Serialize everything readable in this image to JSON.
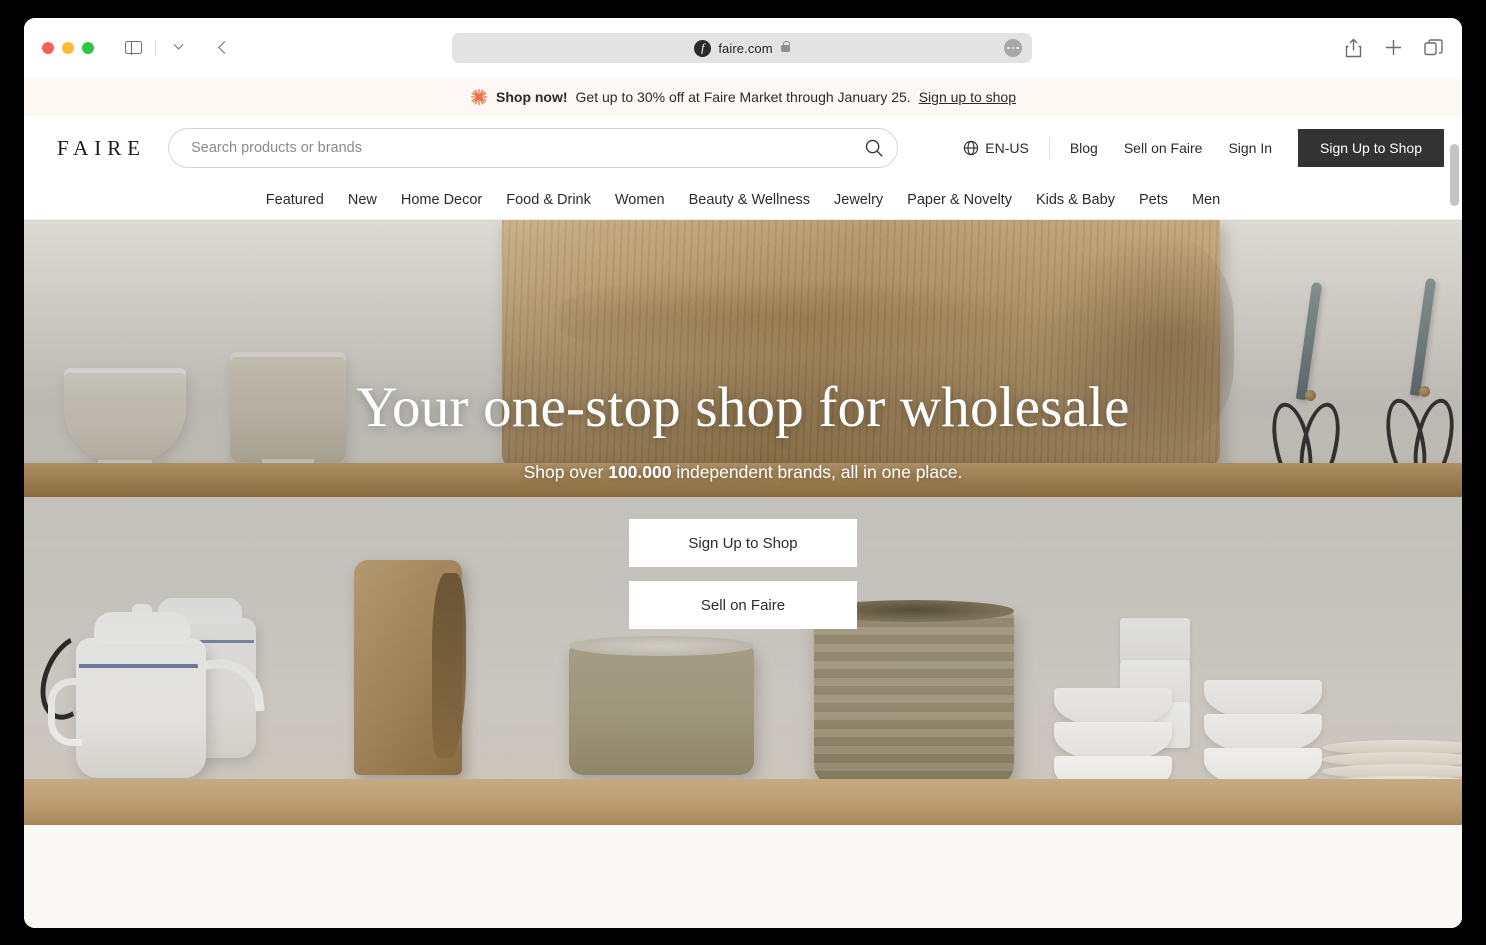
{
  "browser": {
    "traffic_lights": [
      "close",
      "minimize",
      "zoom"
    ],
    "url": "faire.com",
    "toolbar_icons": {
      "sidebar": "sidebar-icon",
      "tab_dropdown": "chevron-down-icon",
      "back": "back-chevron-icon",
      "favicon": "faire-favicon",
      "lock": "lock-icon",
      "page_menu": "ellipsis-icon",
      "share": "share-icon",
      "new_tab": "plus-icon",
      "tab_overview": "tab-overview-icon"
    }
  },
  "promo": {
    "icon": "starburst-icon",
    "strong": "Shop now!",
    "text": " Get up to 30% off at Faire Market through January 25. ",
    "link": "Sign up to shop",
    "accent_color": "#E8704A",
    "background": "#FDF8F4"
  },
  "header": {
    "logo": "FAIRE",
    "search": {
      "placeholder": "Search products or brands",
      "value": "",
      "icon": "search-icon"
    },
    "locale": {
      "icon": "globe-icon",
      "label": "EN-US"
    },
    "links": [
      {
        "label": "Blog"
      },
      {
        "label": "Sell on Faire"
      },
      {
        "label": "Sign In"
      }
    ],
    "cta": {
      "label": "Sign Up to Shop",
      "background": "#333333",
      "color": "#FFFFFF"
    }
  },
  "category_nav": {
    "items": [
      {
        "label": "Featured"
      },
      {
        "label": "New"
      },
      {
        "label": "Home Decor"
      },
      {
        "label": "Food & Drink"
      },
      {
        "label": "Women"
      },
      {
        "label": "Beauty & Wellness"
      },
      {
        "label": "Jewelry"
      },
      {
        "label": "Paper & Novelty"
      },
      {
        "label": "Kids & Baby"
      },
      {
        "label": "Pets"
      },
      {
        "label": "Men"
      }
    ]
  },
  "hero": {
    "title": "Your one-stop shop for wholesale",
    "subtitle_prefix": "Shop over ",
    "subtitle_strong": "100.000",
    "subtitle_suffix": " independent brands, all in one place.",
    "buttons": [
      {
        "label": "Sign Up to Shop"
      },
      {
        "label": "Sell on Faire"
      }
    ],
    "image_description": "Ceramic bowls, enamel teapots, wooden cutting boards and shears on wooden shelves"
  },
  "page": {
    "background": "#FAF8F5"
  }
}
